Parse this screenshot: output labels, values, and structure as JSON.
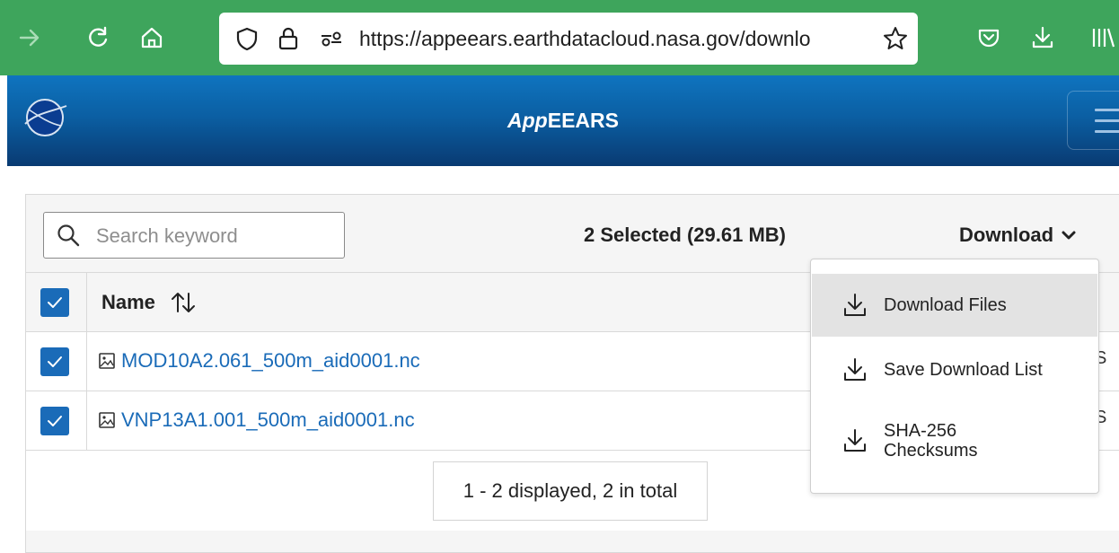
{
  "browser": {
    "url": "https://appeears.earthdatacloud.nasa.gov/downlo"
  },
  "header": {
    "logo_text": "NASA",
    "title_prefix": "App",
    "title_main": "EEARS"
  },
  "toolbar": {
    "search_placeholder": "Search keyword",
    "selected_summary": "2 Selected (29.61 MB)",
    "download_label": "Download"
  },
  "table": {
    "name_header": "Name",
    "rows": [
      {
        "file": "MOD10A2.061_500m_aid0001.nc",
        "trailing": "S",
        "checked": true
      },
      {
        "file": "VNP13A1.001_500m_aid0001.nc",
        "trailing": "S",
        "checked": true
      }
    ]
  },
  "dropdown": {
    "items": [
      {
        "label": "Download Files",
        "active": true
      },
      {
        "label": "Save Download List",
        "active": false
      },
      {
        "label_line1": "SHA-256",
        "label_line2": "Checksums",
        "active": false
      }
    ]
  },
  "pagination": {
    "summary": "1 - 2 displayed, 2 in total"
  }
}
